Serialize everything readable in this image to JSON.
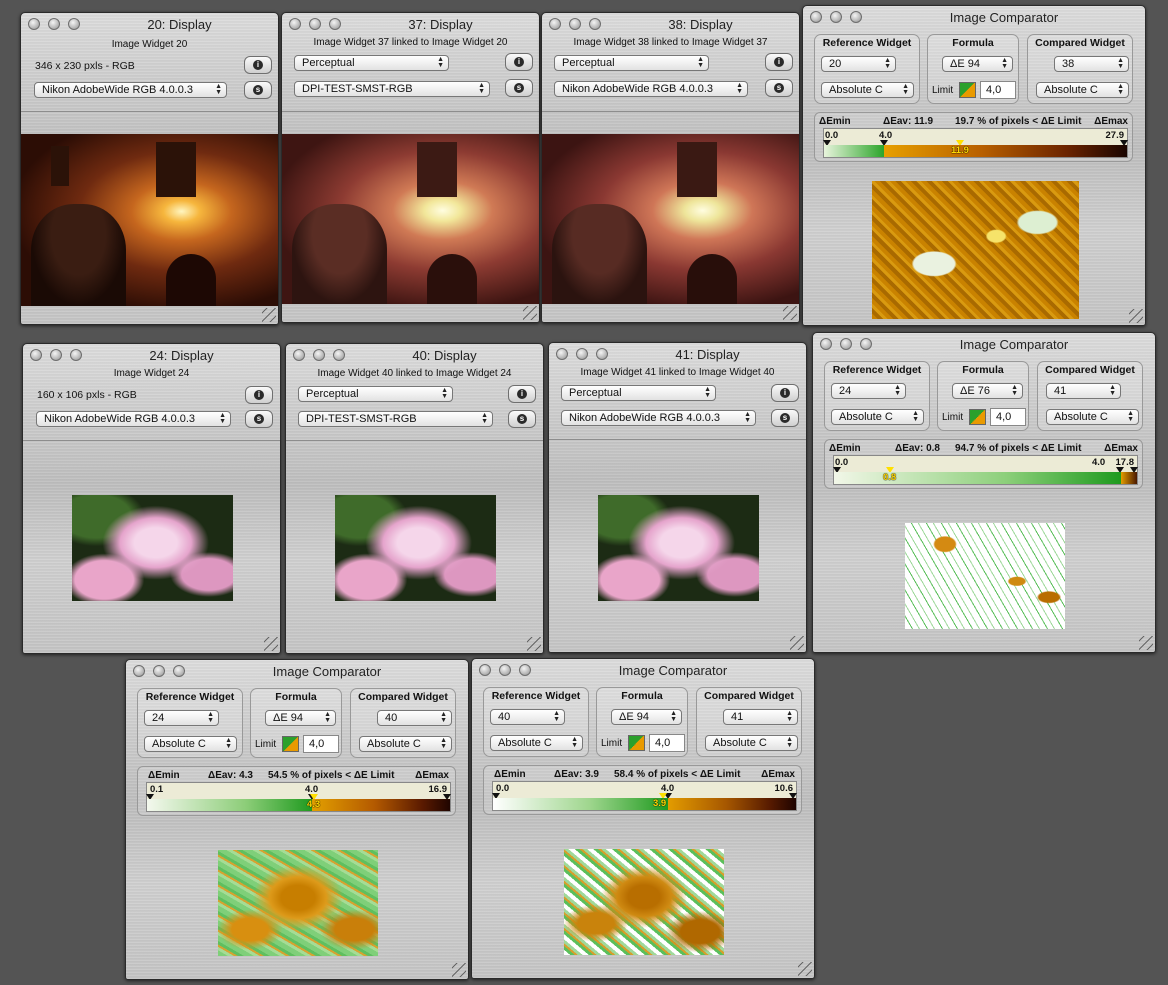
{
  "displays": [
    {
      "title": "20: Display",
      "subtitle": "Image Widget 20",
      "info": "346 x 230 pxls - RGB",
      "profile": "Nikon AdobeWide RGB 4.0.0.3"
    },
    {
      "title": "37: Display",
      "subtitle": "Image Widget 37 linked to Image Widget 20",
      "intent": "Perceptual",
      "profile": "DPI-TEST-SMST-RGB"
    },
    {
      "title": "38: Display",
      "subtitle": "Image Widget 38 linked to Image Widget 37",
      "intent": "Perceptual",
      "profile": "Nikon AdobeWide RGB 4.0.0.3"
    },
    {
      "title": "24: Display",
      "subtitle": "Image Widget 24",
      "info": "160 x 106 pxls - RGB",
      "profile": "Nikon AdobeWide RGB 4.0.0.3"
    },
    {
      "title": "40: Display",
      "subtitle": "Image Widget 40 linked to Image Widget 24",
      "intent": "Perceptual",
      "profile": "DPI-TEST-SMST-RGB"
    },
    {
      "title": "41: Display",
      "subtitle": "Image Widget 41 linked to Image Widget 40",
      "intent": "Perceptual",
      "profile": "Nikon AdobeWide RGB 4.0.0.3"
    }
  ],
  "labels": {
    "ref": "Reference Widget",
    "formula": "Formula",
    "compared": "Compared Widget",
    "limit": "Limit",
    "demin": "ΔEmin",
    "demax": "ΔEmax",
    "comparator_title": "Image Comparator"
  },
  "comparators": [
    {
      "ref": "20",
      "formula": "ΔE 94",
      "compared": "38",
      "ref_mode": "Absolute C",
      "cmp_mode": "Absolute C",
      "limit": "4,0",
      "eav": "ΔEav: 11.9",
      "pct": "19.7 % of pixels < ΔE Limit",
      "min": "0.0",
      "limit_val": "4.0",
      "max": "27.9",
      "avg": "11.9"
    },
    {
      "ref": "24",
      "formula": "ΔE 76",
      "compared": "41",
      "ref_mode": "Absolute C",
      "cmp_mode": "Absolute C",
      "limit": "4,0",
      "eav": "ΔEav: 0.8",
      "pct": "94.7 % of pixels < ΔE Limit",
      "min": "0.0",
      "limit_val": "4.0",
      "max": "17.8",
      "avg": "0.8"
    },
    {
      "ref": "24",
      "formula": "ΔE 94",
      "compared": "40",
      "ref_mode": "Absolute C",
      "cmp_mode": "Absolute C",
      "limit": "4,0",
      "eav": "ΔEav: 4.3",
      "pct": "54.5 % of pixels < ΔE Limit",
      "min": "0.1",
      "limit_val": "4.0",
      "max": "16.9",
      "avg": "4.3"
    },
    {
      "ref": "40",
      "formula": "ΔE 94",
      "compared": "41",
      "ref_mode": "Absolute C",
      "cmp_mode": "Absolute C",
      "limit": "4,0",
      "eav": "ΔEav: 3.9",
      "pct": "58.4 % of pixels < ΔE Limit",
      "min": "0.0",
      "limit_val": "4.0",
      "max": "10.6",
      "avg": "3.9"
    }
  ],
  "icons": {
    "info_button": "info-icon",
    "settings_button": "s-icon"
  }
}
